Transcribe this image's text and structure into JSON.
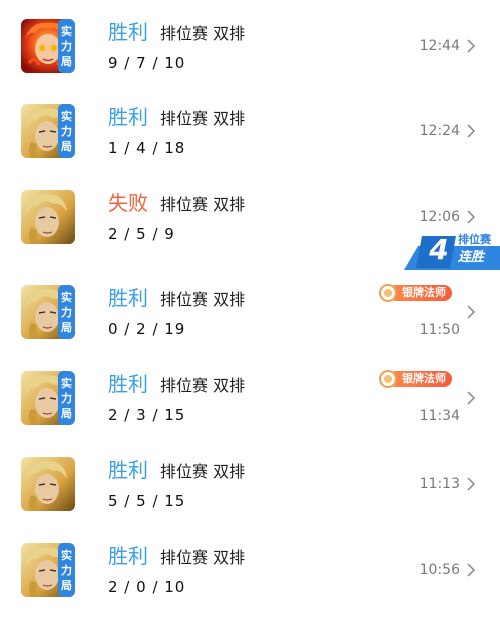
{
  "matches": [
    {
      "result": "胜利",
      "mode": "排位赛 双排",
      "kda": "9 / 7 / 10",
      "time": "12:44",
      "badge": [
        "实",
        "力",
        "局"
      ],
      "hero": "fire-hero-icon"
    },
    {
      "result": "胜利",
      "mode": "排位赛 双排",
      "kda": "1 / 4 / 18",
      "time": "12:24",
      "badge": [
        "实",
        "力",
        "局"
      ],
      "hero": "golden-hero-icon"
    },
    {
      "result": "失败",
      "mode": "排位赛 双排",
      "kda": "2 / 5 / 9",
      "time": "12:06",
      "badge": null,
      "hero": "golden-hero-icon"
    },
    {
      "result": "胜利",
      "mode": "排位赛 双排",
      "kda": "0 / 2 / 19",
      "time": "11:50",
      "badge": [
        "实",
        "力",
        "局"
      ],
      "hero": "golden-hero-icon",
      "honor": "银牌法师"
    },
    {
      "result": "胜利",
      "mode": "排位赛 双排",
      "kda": "2 / 3 / 15",
      "time": "11:34",
      "badge": [
        "实",
        "力",
        "局"
      ],
      "hero": "golden-hero-icon",
      "honor": "银牌法师"
    },
    {
      "result": "胜利",
      "mode": "排位赛 双排",
      "kda": "5 / 5 / 15",
      "time": "11:13",
      "badge": null,
      "hero": "golden-hero-icon"
    },
    {
      "result": "胜利",
      "mode": "排位赛 双排",
      "kda": "2 / 0 / 10",
      "time": "10:56",
      "badge": [
        "实",
        "力",
        "局"
      ],
      "hero": "golden-hero-icon"
    }
  ],
  "streak": {
    "number": "4",
    "top": "排位赛",
    "bottom": "连胜"
  },
  "colors": {
    "win": "#3aa0e8",
    "lose": "#f0643c",
    "badge": "#2f86e0",
    "honor": "#f55a3a",
    "streak": "#2f86e0"
  }
}
